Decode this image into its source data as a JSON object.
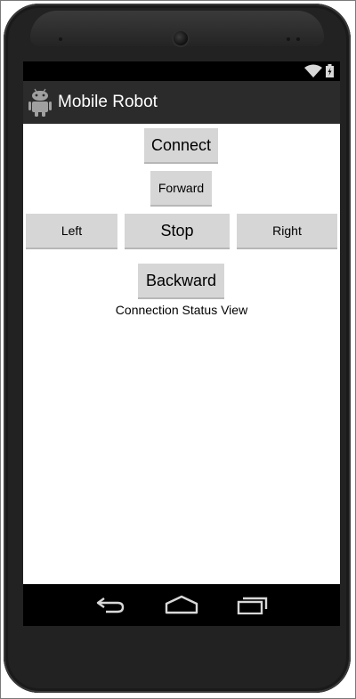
{
  "app": {
    "title": "Mobile Robot"
  },
  "controls": {
    "connect_label": "Connect",
    "forward_label": "Forward",
    "left_label": "Left",
    "stop_label": "Stop",
    "right_label": "Right",
    "backward_label": "Backward"
  },
  "status": {
    "text": "Connection Status View"
  },
  "icons": {
    "statusbar": [
      "wifi-icon",
      "battery-icon"
    ],
    "actionbar": "android-icon",
    "navbar": [
      "back-icon",
      "home-icon",
      "recent-apps-icon"
    ]
  },
  "colors": {
    "button_bg": "#d6d6d6",
    "action_bar": "#2b2b2b",
    "status_bar": "#000000",
    "screen_bg": "#ffffff"
  }
}
